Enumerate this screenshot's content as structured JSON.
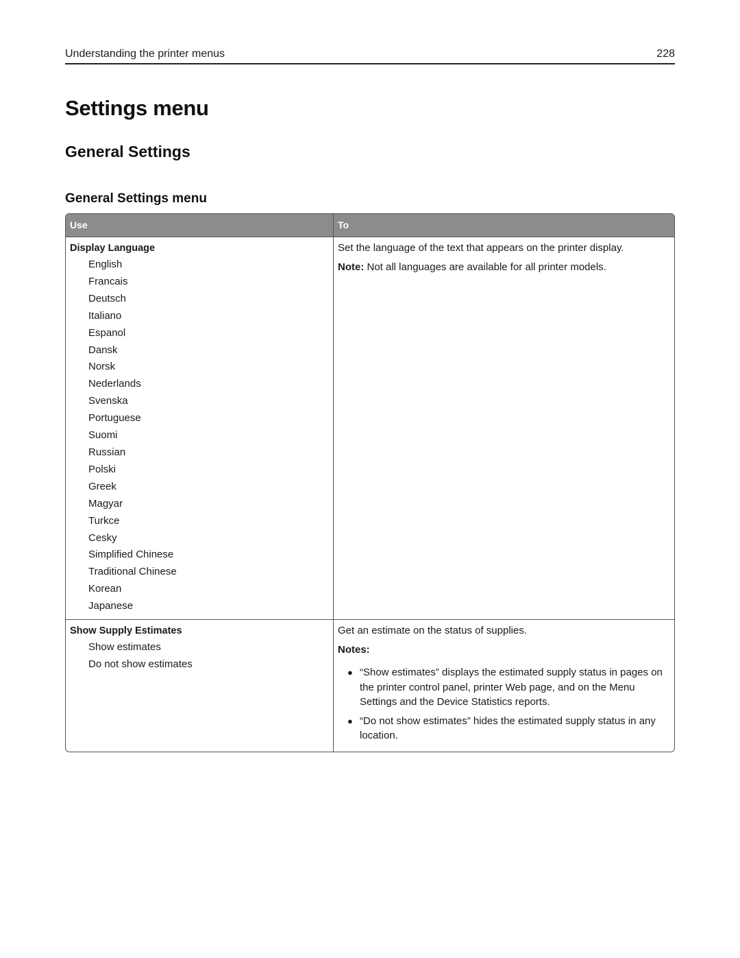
{
  "header": {
    "running_title": "Understanding the printer menus",
    "page_number": "228"
  },
  "headings": {
    "h1": "Settings menu",
    "h2": "General Settings",
    "h3": "General Settings menu"
  },
  "table": {
    "columns": [
      "Use",
      "To"
    ],
    "rows": [
      {
        "setting": "Display Language",
        "options": [
          "English",
          "Francais",
          "Deutsch",
          "Italiano",
          "Espanol",
          "Dansk",
          "Norsk",
          "Nederlands",
          "Svenska",
          "Portuguese",
          "Suomi",
          "Russian",
          "Polski",
          "Greek",
          "Magyar",
          "Turkce",
          "Cesky",
          "Simplified Chinese",
          "Traditional Chinese",
          "Korean",
          "Japanese"
        ],
        "description": "Set the language of the text that appears on the printer display.",
        "note_label": "Note:",
        "note_text": " Not all languages are available for all printer models."
      },
      {
        "setting": "Show Supply Estimates",
        "options": [
          "Show estimates",
          "Do not show estimates"
        ],
        "description": "Get an estimate on the status of supplies.",
        "notes_heading": "Notes:",
        "bullets": [
          "“Show estimates” displays the estimated supply status in pages on the printer control panel, printer Web page, and on the Menu Settings and the Device Statistics reports.",
          "“Do not show estimates” hides the estimated supply status in any location."
        ]
      }
    ]
  }
}
